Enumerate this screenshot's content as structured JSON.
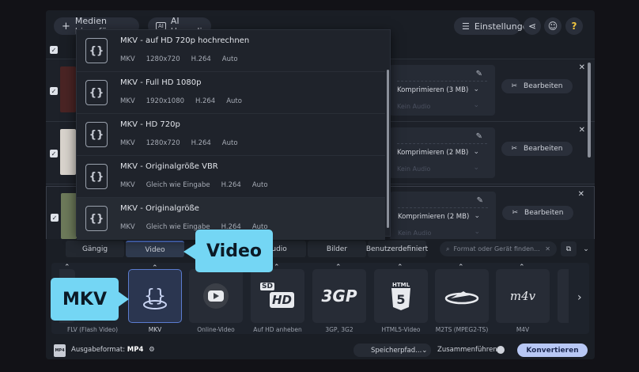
{
  "toolbar": {
    "add_media": "Medien hinzufügen",
    "ai_upscaling": "AI Upscaling",
    "settings": "Einstellungen"
  },
  "files": [
    {
      "compress": "Komprimieren (3 MB)",
      "audio": "Kein Audio",
      "edit": "Bearbeiten"
    },
    {
      "compress": "Komprimieren (2 MB)",
      "audio": "Kein Audio",
      "edit": "Bearbeiten"
    },
    {
      "compress": "Komprimieren (2 MB)",
      "audio": "Kein Audio",
      "edit": "Bearbeiten"
    }
  ],
  "presets": [
    {
      "title": "MKV - auf HD 720p hochrechnen",
      "res": "1280x720",
      "codec": "H.264",
      "extra": "Auto"
    },
    {
      "title": "MKV - Full HD 1080p",
      "res": "1920x1080",
      "codec": "H.264",
      "extra": "Auto"
    },
    {
      "title": "MKV - HD 720p",
      "res": "1280x720",
      "codec": "H.264",
      "extra": "Auto"
    },
    {
      "title": "MKV - Originalgröße VBR",
      "res": "Gleich wie Eingabe",
      "codec": "H.264",
      "extra": "Auto"
    },
    {
      "title": "MKV - Originalgröße",
      "res": "Gleich wie Eingabe",
      "codec": "H.264",
      "extra": "Auto"
    }
  ],
  "preset_container": "MKV",
  "tabs": [
    "Gängig",
    "Video",
    "Audio",
    "Bilder",
    "Benutzerdefiniert"
  ],
  "search_placeholder": "Format oder Gerät finden...",
  "formats": [
    {
      "name": "FLV (Flash Video)",
      "icon": "flv-icon"
    },
    {
      "name": "MKV",
      "icon": "mkv-icon"
    },
    {
      "name": "Online-Video",
      "icon": "youtube-icon"
    },
    {
      "name": "Auf HD anheben",
      "icon": "hd-icon",
      "badge_top": "SD",
      "badge_main": "HD"
    },
    {
      "name": "3GP, 3G2",
      "icon": "3gp-icon",
      "badge_main": "3GP"
    },
    {
      "name": "HTML5-Video",
      "icon": "html5-icon",
      "badge_top": "HTML"
    },
    {
      "name": "M2TS (MPEG2-TS)",
      "icon": "bluray-icon"
    },
    {
      "name": "M4V",
      "icon": "m4v-icon",
      "badge_main": "m4v"
    }
  ],
  "footer": {
    "output_label": "Ausgabeformat:",
    "output_format": "MP4",
    "save_path": "Speicherpfad...",
    "merge": "Zusammenführen:",
    "convert": "Konvertieren"
  },
  "callouts": {
    "video": "Video",
    "mkv": "MKV"
  },
  "colors": {
    "accent": "#5b7cd0",
    "callout": "#74d6f4",
    "convert_btn": "#b8c8f5"
  }
}
